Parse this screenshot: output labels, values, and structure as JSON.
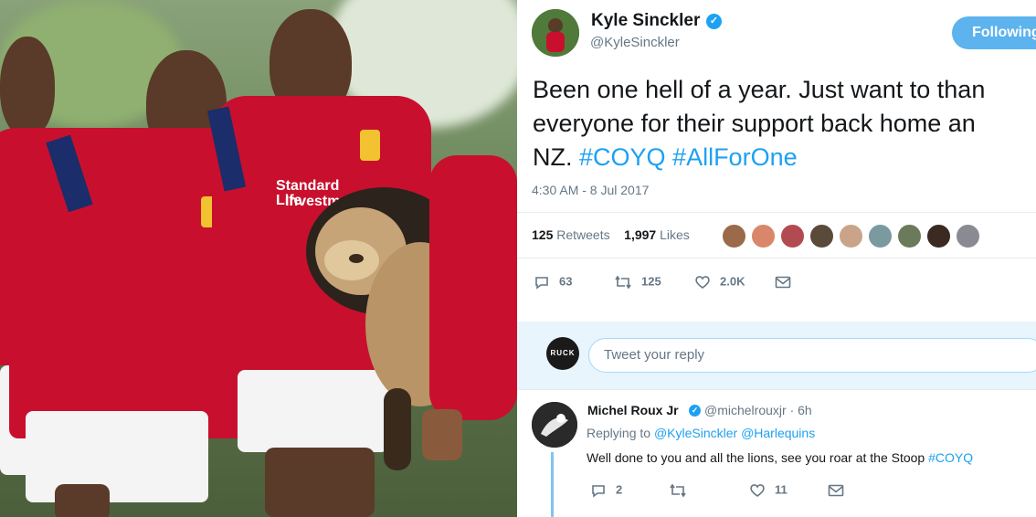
{
  "tweet": {
    "author_name": "Kyle Sinckler",
    "author_handle": "@KyleSinckler",
    "follow_label": "Following",
    "text_lines": [
      "Been one hell of a year. Just want to than",
      "everyone for their support back home an",
      "NZ. "
    ],
    "hashtags": [
      "#COYQ",
      "#AllForOne"
    ],
    "timestamp": "4:30 AM - 8 Jul 2017",
    "retweets_count": "125",
    "retweets_label": "Retweets",
    "likes_count": "1,997",
    "likes_label": "Likes",
    "actions": {
      "reply_count": "63",
      "retweet_count": "125",
      "like_count": "2.0K"
    }
  },
  "reply_box": {
    "avatar_text": "RUCK",
    "placeholder": "Tweet your reply"
  },
  "reply": {
    "name": "Michel Roux Jr",
    "handle_time": "@michelrouxjr · 6h",
    "replying_prefix": "Replying to ",
    "replying_to": "@KyleSinckler @Harlequins",
    "text": "Well done to you and all the lions, see you roar at the Stoop ",
    "hashtag": "#COYQ",
    "reply_count": "2",
    "like_count": "11"
  },
  "photo": {
    "sponsor_text_1": "Standard Life",
    "sponsor_text_2": "Investme"
  },
  "colors": {
    "accent": "#1da1f2",
    "jersey": "#c8102e"
  }
}
